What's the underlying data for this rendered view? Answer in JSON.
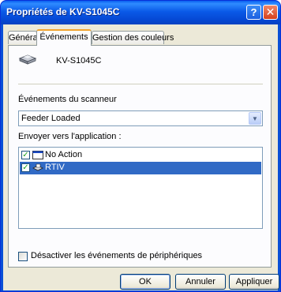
{
  "window": {
    "title": "Propriétés de KV-S1045C",
    "help_button": "?",
    "close_button": "✕"
  },
  "tabs": [
    {
      "label": "Général"
    },
    {
      "label": "Événements"
    },
    {
      "label": "Gestion des couleurs"
    }
  ],
  "device": {
    "icon": "scanner-icon",
    "name": "KV-S1045C"
  },
  "events": {
    "label": "Événements du scanneur",
    "selected": "Feeder Loaded"
  },
  "send_to": {
    "label": "Envoyer vers l'application :",
    "items": [
      {
        "label": "No Action",
        "checked": true,
        "selected": false,
        "icon": "window-icon"
      },
      {
        "label": "RTIV",
        "checked": true,
        "selected": true,
        "icon": "scanner-app-icon"
      }
    ]
  },
  "disable_events": {
    "label": "Désactiver les événements de périphériques",
    "checked": false
  },
  "buttons": {
    "ok": "OK",
    "cancel": "Annuler",
    "apply": "Appliquer"
  },
  "colors": {
    "titlebar": "#0a5ae8",
    "selection": "#316ac5",
    "face": "#ece9d8",
    "tab_highlight": "#f1a22d"
  }
}
